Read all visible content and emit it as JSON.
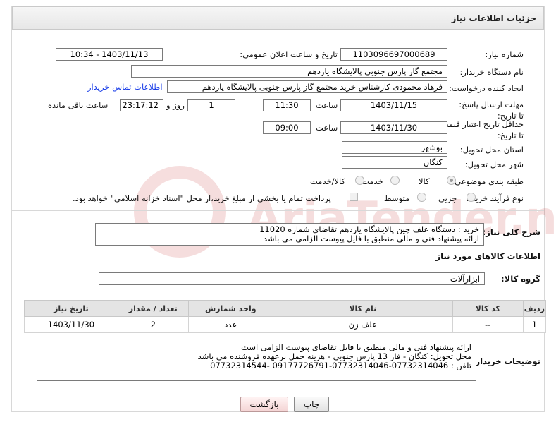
{
  "header": {
    "title": "جزئیات اطلاعات نیاز"
  },
  "fields": {
    "need_number_label": "شماره نیاز:",
    "need_number": "1103096697000689",
    "announce_datetime_label": "تاریخ و ساعت اعلان عمومی:",
    "announce_datetime": "1403/11/13 - 10:34",
    "buyer_org_label": "نام دستگاه خریدار:",
    "buyer_org": "مجتمع گاز پارس جنوبی  پالایشگاه یازدهم",
    "requester_label": "ایجاد کننده درخواست:",
    "requester": "فرهاد محمودی کارشناس خرید مجتمع گاز پارس جنوبی  پالایشگاه یازدهم",
    "buyer_contact_link": "اطلاعات تماس خریدار",
    "deadline_label": "مهلت ارسال پاسخ: تا تاریخ:",
    "deadline_date": "1403/11/15",
    "time_label": "ساعت",
    "deadline_time": "11:30",
    "days_value": "1",
    "days_label": "روز و",
    "remaining_time": "23:17:12",
    "remaining_label": "ساعت باقی مانده",
    "price_validity_label": "حداقل تاریخ اعتبار قیمت: تا تاریخ:",
    "price_validity_date": "1403/11/30",
    "price_validity_time": "09:00",
    "province_label": "استان محل تحویل:",
    "province": "بوشهر",
    "city_label": "شهر محل تحویل:",
    "city": "کنگان",
    "category_label": "طبقه بندی موضوعی:",
    "category_options": [
      {
        "label": "کالا",
        "selected": true
      },
      {
        "label": "خدمت",
        "selected": false
      },
      {
        "label": "کالا/خدمت",
        "selected": false
      }
    ],
    "purchase_type_label": "نوع فرآیند خرید :",
    "purchase_type_options": [
      {
        "label": "جزیی",
        "selected": false
      },
      {
        "label": "متوسط",
        "selected": false
      }
    ],
    "payment_note": "پرداخت تمام یا بخشی از مبلغ خرید،از محل \"اسناد خزانه اسلامی\" خواهد بود."
  },
  "description": {
    "label": "شرح کلی نیاز:",
    "text": "خرید :   دستگاه علف چین پالایشگاه یازدهم تقاضای شماره 11020\nارائه پیشنهاد فنی و مالی منطبق با فایل پیوست الزامی می باشد"
  },
  "goods_section": {
    "title": "اطلاعات کالاهای مورد نیاز",
    "group_label": "گروه کالا:",
    "group_value": "ابزارآلات"
  },
  "table": {
    "headers": [
      "ردیف",
      "کد کالا",
      "نام کالا",
      "واحد شمارش",
      "تعداد / مقدار",
      "تاریخ نیاز"
    ],
    "rows": [
      [
        "1",
        "--",
        "علف زن",
        "عدد",
        "2",
        "1403/11/30"
      ]
    ]
  },
  "buyer_notes": {
    "label": "توضیحات خریدار:",
    "text": "ارائه پیشنهاد فنی و مالی منطبق با فایل تقاضای پیوست الزامی است\nمحل تحویل: کنگان - فاز 13 پارس جنوبی - هزینه حمل برعهده فروشنده می باشد\nتلفن : 07732314046-07732314046-09177726791 -07732314544"
  },
  "buttons": {
    "print": "چاپ",
    "back": "بازگشت"
  },
  "watermark": {
    "text": "AriaTender.neT"
  }
}
